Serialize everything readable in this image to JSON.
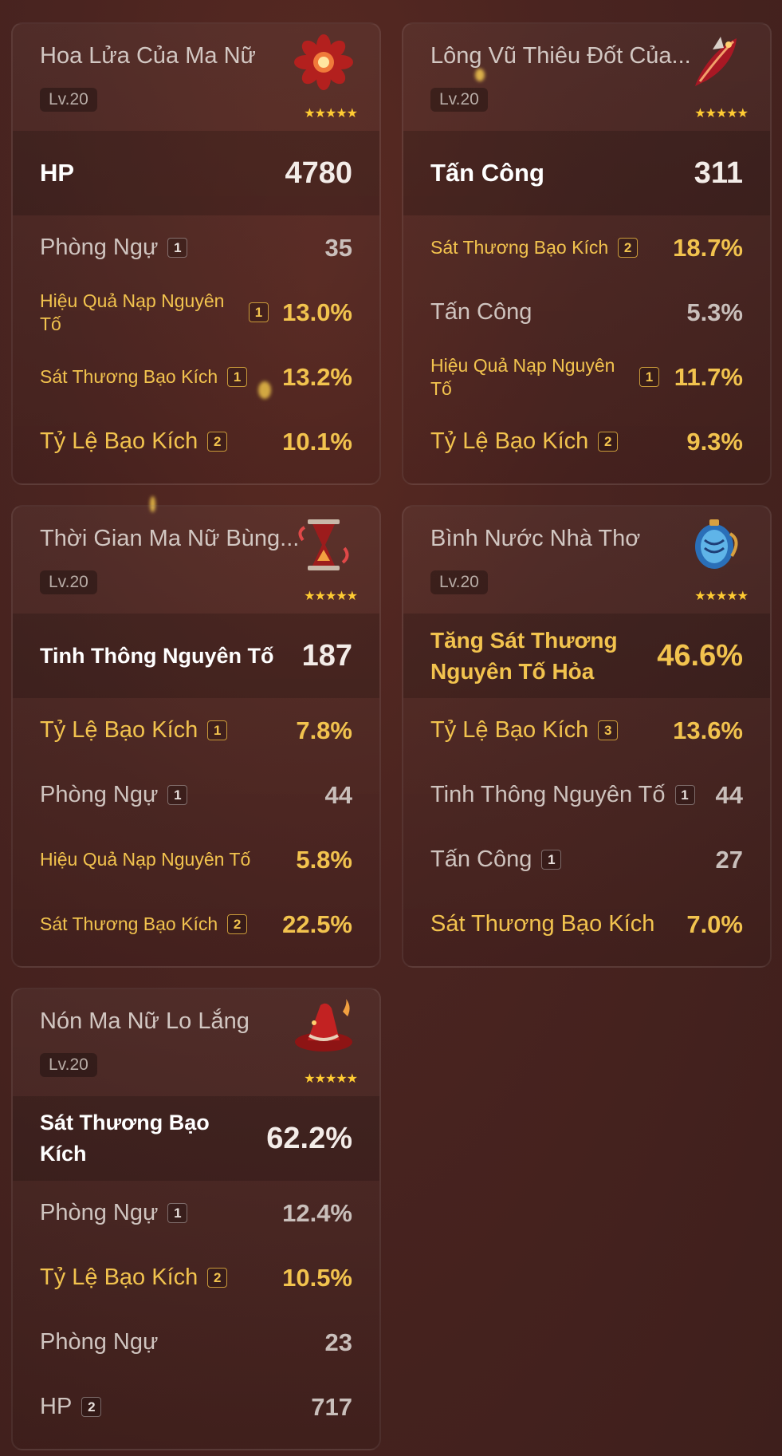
{
  "artifacts": [
    {
      "name": "Hoa Lửa Của Ma Nữ",
      "level": "Lv.20",
      "stars": "★★★★★",
      "icon": "flower-icon",
      "main": {
        "label": "HP",
        "value": "4780"
      },
      "subs": [
        {
          "label": "Phòng Ngự",
          "roll": "1",
          "value": "35",
          "gold": false,
          "small": false
        },
        {
          "label": "Hiệu Quả Nạp Nguyên Tố",
          "roll": "1",
          "value": "13.0%",
          "gold": true,
          "small": true
        },
        {
          "label": "Sát Thương Bạo Kích",
          "roll": "1",
          "value": "13.2%",
          "gold": true,
          "small": true
        },
        {
          "label": "Tỷ Lệ Bạo Kích",
          "roll": "2",
          "value": "10.1%",
          "gold": true,
          "small": false
        }
      ]
    },
    {
      "name": "Lông Vũ Thiêu Đốt Của...",
      "level": "Lv.20",
      "stars": "★★★★★",
      "icon": "feather-icon",
      "main": {
        "label": "Tấn Công",
        "value": "311"
      },
      "subs": [
        {
          "label": "Sát Thương Bạo Kích",
          "roll": "2",
          "value": "18.7%",
          "gold": true,
          "small": true
        },
        {
          "label": "Tấn Công",
          "roll": "",
          "value": "5.3%",
          "gold": false,
          "small": false
        },
        {
          "label": "Hiệu Quả Nạp Nguyên Tố",
          "roll": "1",
          "value": "11.7%",
          "gold": true,
          "small": true
        },
        {
          "label": "Tỷ Lệ Bạo Kích",
          "roll": "2",
          "value": "9.3%",
          "gold": true,
          "small": false
        }
      ]
    },
    {
      "name": "Thời Gian Ma Nữ Bùng...",
      "level": "Lv.20",
      "stars": "★★★★★",
      "icon": "hourglass-icon",
      "main": {
        "label": "Tinh Thông Nguyên Tố",
        "value": "187"
      },
      "subs": [
        {
          "label": "Tỷ Lệ Bạo Kích",
          "roll": "1",
          "value": "7.8%",
          "gold": true,
          "small": false
        },
        {
          "label": "Phòng Ngự",
          "roll": "1",
          "value": "44",
          "gold": false,
          "small": false
        },
        {
          "label": "Hiệu Quả Nạp Nguyên Tố",
          "roll": "",
          "value": "5.8%",
          "gold": true,
          "small": true
        },
        {
          "label": "Sát Thương Bạo Kích",
          "roll": "2",
          "value": "22.5%",
          "gold": true,
          "small": true
        }
      ]
    },
    {
      "name": "Bình Nước Nhà Thơ",
      "level": "Lv.20",
      "stars": "★★★★★",
      "icon": "goblet-icon",
      "main": {
        "label": "Tăng Sát Thương Nguyên Tố Hỏa",
        "value": "46.6%"
      },
      "subs": [
        {
          "label": "Tỷ Lệ Bạo Kích",
          "roll": "3",
          "value": "13.6%",
          "gold": true,
          "small": false
        },
        {
          "label": "Tinh Thông Nguyên Tố",
          "roll": "1",
          "value": "44",
          "gold": false,
          "small": false
        },
        {
          "label": "Tấn Công",
          "roll": "1",
          "value": "27",
          "gold": false,
          "small": false
        },
        {
          "label": "Sát Thương Bạo Kích",
          "roll": "",
          "value": "7.0%",
          "gold": true,
          "small": false
        }
      ]
    },
    {
      "name": "Nón Ma Nữ Lo Lắng",
      "level": "Lv.20",
      "stars": "★★★★★",
      "icon": "witch-hat-icon",
      "main": {
        "label": "Sát Thương Bạo Kích",
        "value": "62.2%"
      },
      "subs": [
        {
          "label": "Phòng Ngự",
          "roll": "1",
          "value": "12.4%",
          "gold": false,
          "small": false
        },
        {
          "label": "Tỷ Lệ Bạo Kích",
          "roll": "2",
          "value": "10.5%",
          "gold": true,
          "small": false
        },
        {
          "label": "Phòng Ngự",
          "roll": "",
          "value": "23",
          "gold": false,
          "small": false
        },
        {
          "label": "HP",
          "roll": "2",
          "value": "717",
          "gold": false,
          "small": false
        }
      ]
    }
  ],
  "colors": {
    "gold": "#f2c34e",
    "white": "#ffffff",
    "muted": "#cfc4bf",
    "background": "#4a2420"
  }
}
